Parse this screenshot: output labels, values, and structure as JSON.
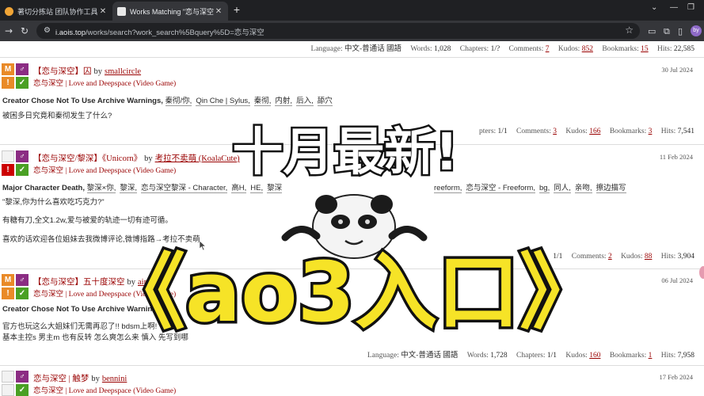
{
  "browser": {
    "tabs": [
      {
        "title": "著切分拣站 团队协作工具 - 砺",
        "active": false
      },
      {
        "title": "Works Matching \"恋与深空\" | A",
        "active": true
      }
    ],
    "address": {
      "host": "i.aois.top",
      "path": "/works/search?work_search%5Bquery%5D=恋与深空"
    },
    "profile_initials": "by"
  },
  "stats_rows": [
    {
      "language_label": "Language:",
      "language": "中文-普通话 國語",
      "words_label": "Words:",
      "words": "1,028",
      "chapters_label": "Chapters:",
      "chapters": "1/?",
      "comments_label": "Comments:",
      "comments": "7",
      "kudos_label": "Kudos:",
      "kudos": "852",
      "bookmarks_label": "Bookmarks:",
      "bookmarks": "15",
      "hits_label": "Hits:",
      "hits": "22,585"
    },
    {
      "chapters_label": "pters:",
      "chapters": "1/1",
      "comments_label": "Comments:",
      "comments": "3",
      "kudos_label": "Kudos:",
      "kudos": "166",
      "bookmarks_label": "Bookmarks:",
      "bookmarks": "3",
      "hits_label": "Hits:",
      "hits": "7,541"
    },
    {
      "chapters": "1/1",
      "comments_label": "Comments:",
      "comments": "2",
      "kudos_label": "Kudos:",
      "kudos": "88",
      "hits_label": "Hits:",
      "hits": "3,904"
    },
    {
      "language_label": "Language:",
      "language": "中文-普通话 國語",
      "words_label": "Words:",
      "words": "1,728",
      "chapters_label": "Chapters:",
      "chapters": "1/1",
      "kudos_label": "Kudos:",
      "kudos": "160",
      "bookmarks_label": "Bookmarks:",
      "bookmarks": "1",
      "hits_label": "Hits:",
      "hits": "7,958"
    }
  ],
  "works": [
    {
      "req": [
        "M",
        "♂",
        "!",
        "✓"
      ],
      "title": "【恋与深空】囚",
      "by": "by",
      "author": "smallcircle",
      "fandom": "恋与深空 | Love and Deepspace (Video Game)",
      "date": "30 Jul 2024",
      "warning": "Creator Chose Not To Use Archive Warnings,",
      "tags": [
        "秦彻/你,",
        "Qin Che | Sylus,",
        "秦彻,",
        "内射,",
        "后入,",
        "舔穴"
      ],
      "summary": "被困多日究竟和秦彻发生了什么?"
    },
    {
      "req": [
        "",
        "♂",
        "!",
        "✓"
      ],
      "title": "【恋与深空/黎深】《Unicorn》",
      "by": "by",
      "author": "考拉不卖萌 (KoalaCute)",
      "fandom": "恋与深空 | Love and Deepspace (Video Game)",
      "date": "11 Feb 2024",
      "warning": "Major Character Death,",
      "tags": [
        "黎深×你,",
        "黎深,",
        "恋与深空黎深 - Character,",
        "高H,",
        "HE,",
        "黎深"
      ],
      "tags_right": [
        "reeform,",
        "恋与深空 - Freeform,",
        "bg,",
        "同人,",
        "亲吻,",
        "擦边描写"
      ],
      "summary_lines": [
        "\"黎深,你为什么喜欢吃巧克力?\"",
        "有糖有刀,全文1.2w,爱与被爱的轨迹一切有迹可循。",
        "喜欢的话欢迎各位姐妹去我微博评论,微博指路→考拉不卖萌"
      ]
    },
    {
      "req": [
        "M",
        "♂",
        "!",
        "✓"
      ],
      "title": "【恋与深空】五十度深空",
      "by": "by",
      "author": "aim",
      "fandom": "恋与深空 | Love and Deepspace (Video Game)",
      "date": "06 Jul 2024",
      "warning": "Creator Chose Not To Use Archive Warnings,",
      "summary_lines": [
        "官方也玩这么大姐妹们无需再忍了!! bdsm上啊!",
        "基本主控s 男主m 也有反转 怎么爽怎么来 慎入 先写到哪"
      ]
    },
    {
      "req": [
        "",
        "♂",
        "",
        "✓"
      ],
      "title": "恋与深空 | 触梦",
      "by": "by",
      "author": "bennini",
      "fandom": "恋与深空 | Love and Deepspace (Video Game)",
      "date": "17 Feb 2024"
    }
  ],
  "overlay": {
    "headline": "十月最新!",
    "banner": "《ao3入口》"
  },
  "colors": {
    "ao3_red": "#990000",
    "rating_orange": "#e98a28",
    "rating_red": "#cc0000",
    "check_green": "#4aa024",
    "category_purple": "#8b2c83",
    "banner_yellow": "#f6e327"
  }
}
